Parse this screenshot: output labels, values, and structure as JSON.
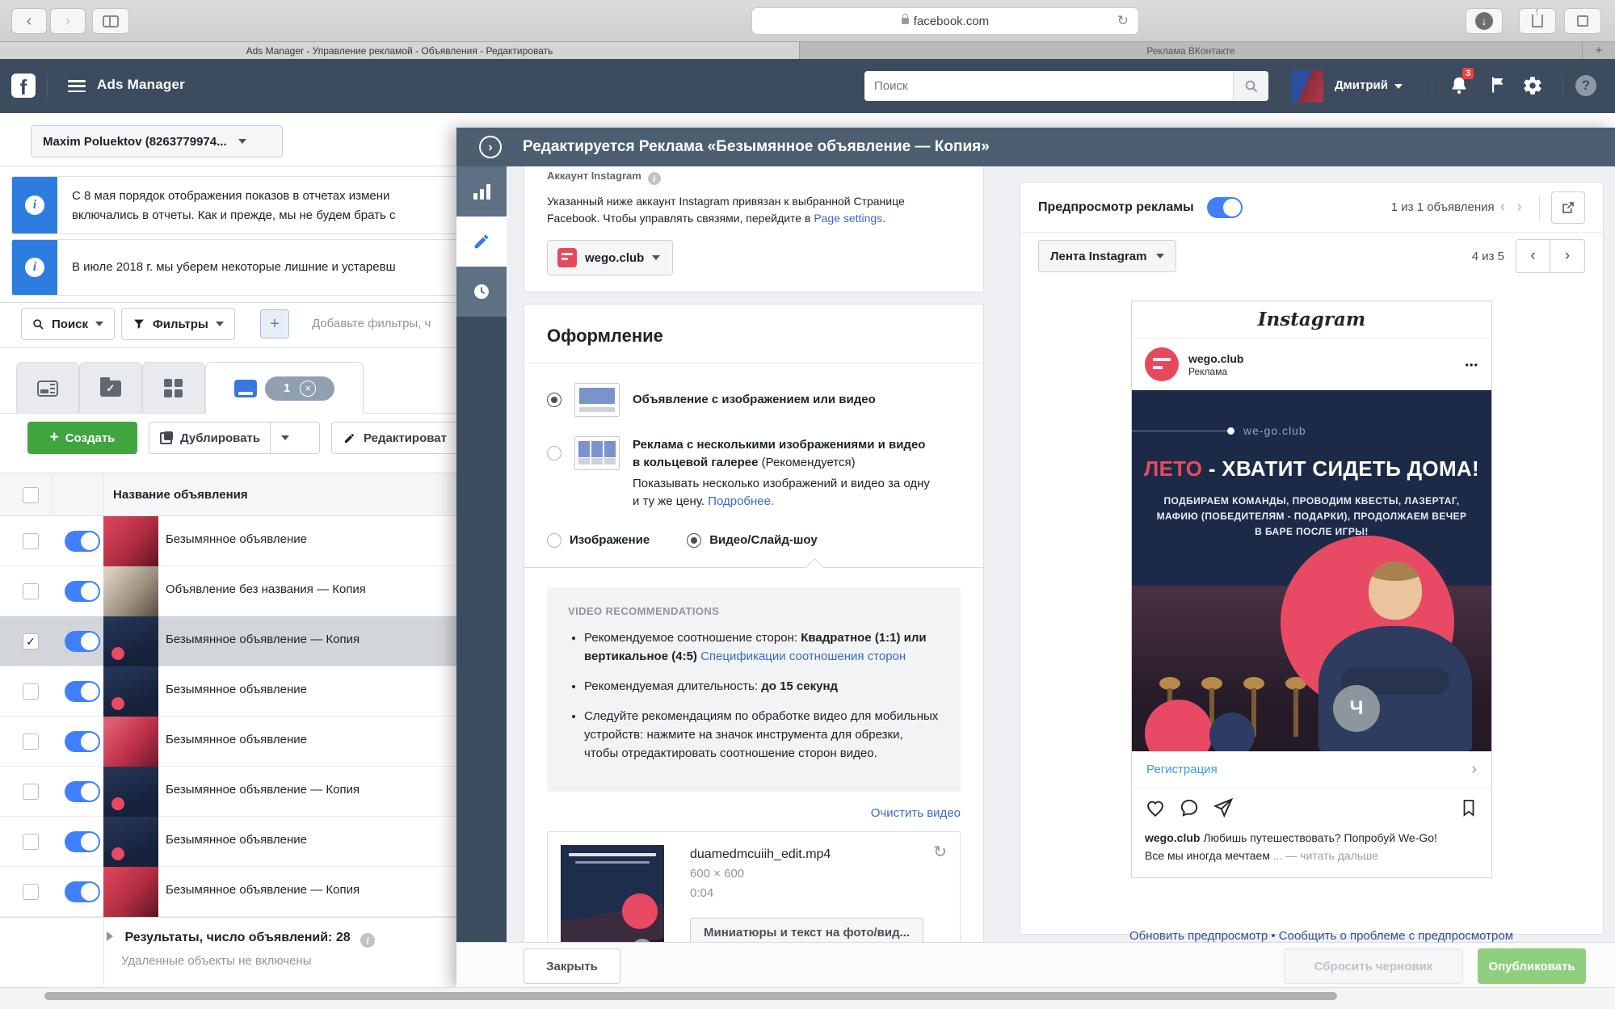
{
  "browser": {
    "url": "facebook.com",
    "tabs": [
      {
        "title": "Ads Manager - Управление рекламой - Объявления - Редактировать"
      },
      {
        "title": "Реклама ВКонтакте"
      }
    ],
    "new_tab_label": "+"
  },
  "icons": {
    "back": "‹",
    "forward": "›",
    "reload": "↻",
    "download_arrow": "↓",
    "plus": "+",
    "check": "✓",
    "dots": "•••",
    "chevron_right": "›",
    "chevron_left": "‹",
    "question": "?",
    "info": "i",
    "close": "×",
    "refresh": "↻"
  },
  "header": {
    "app_title": "Ads Manager",
    "search_placeholder": "Поиск",
    "user_name": "Дмитрий",
    "notification_count": "3"
  },
  "left_panel": {
    "account_selector": "Maxim Poluektov (8263779974...",
    "banners": [
      {
        "line1": "С 8 мая порядок отображения показов в отчетах измени",
        "line2": "включались в отчеты. Как и прежде, мы не будем брать с"
      },
      {
        "line1": "В июле 2018 г. мы уберем некоторые лишние и устаревш",
        "line2": ""
      }
    ],
    "search_button": "Поиск",
    "filters_button": "Фильтры",
    "filters_placeholder": "Добавьте фильтры, ч",
    "active_tab_badge": "1",
    "toolbar": {
      "create": "Создать",
      "duplicate": "Дублировать",
      "edit": "Редактироват"
    },
    "table": {
      "name_header": "Название объявления",
      "rows": [
        {
          "name": "Безымянное объявление",
          "checked": false
        },
        {
          "name": "Объявление без названия — Копия",
          "checked": false
        },
        {
          "name": "Безымянное объявление — Копия",
          "checked": true
        },
        {
          "name": "Безымянное объявление",
          "checked": false
        },
        {
          "name": "Безымянное объявление",
          "checked": false
        },
        {
          "name": "Безымянное объявление — Копия",
          "checked": false
        },
        {
          "name": "Безымянное объявление",
          "checked": false
        },
        {
          "name": "Безымянное объявление — Копия",
          "checked": false
        }
      ],
      "results": "Результаты, число объявлений: 28",
      "results_note": "Удаленные объекты не включены"
    }
  },
  "editor": {
    "title": "Редактируется Реклама «Безымянное объявление — Копия»",
    "instagram": {
      "heading": "Аккаунт Instagram",
      "body": "Указанный ниже аккаунт Instagram привязан к выбранной Странице Facebook. Чтобы управлять связями, перейдите в ",
      "link": "Page settings",
      "period": ".",
      "account": "wego.club"
    },
    "format": {
      "heading": "Оформление",
      "single_label": "Объявление с изображением или видео",
      "carousel_bold": "Реклама с несколькими изображениями и видео в кольцевой галерее",
      "carousel_tag": " (Рекомендуется)",
      "carousel_desc": "Показывать несколько изображений и видео за одну и ту же цену. ",
      "carousel_link": "Подробнее.",
      "image_label": "Изображение",
      "video_label": "Видео/Слайд-шоу"
    },
    "video_recs": {
      "heading": "VIDEO RECOMMENDATIONS",
      "b1_pre": "Рекомендуемое соотношение сторон: ",
      "b1_bold": "Квадратное (1:1) или вертикальное (4:5) ",
      "b1_link": "Спецификации соотношения сторон",
      "b2_pre": "Рекомендуемая длительность: ",
      "b2_bold": "до 15 секунд",
      "b3": "Следуйте рекомендациям по обработке видео для мобильных устройств: нажмите на значок инструмента для обрезки, чтобы отредактировать соотношение сторон видео."
    },
    "clear_video": "Очистить видео",
    "video": {
      "filename": "duamedmcuiih_edit.mp4",
      "dimensions": "600 × 600",
      "duration": "0:04",
      "thumbs_button": "Миниатюры и текст на фото/вид..."
    },
    "close_button": "Закрыть"
  },
  "preview": {
    "title": "Предпросмотр рекламы",
    "ads_counter": "1 из 1 объявления",
    "placement": "Лента Instagram",
    "placement_counter": "4 из 5",
    "ig": {
      "wordmark": "Instagram",
      "account": "wego.club",
      "sponsored": "Реклама",
      "ad_brand": "we-go.club",
      "headline_accent": "ЛЕТО",
      "headline_rest": " - ХВАТИТ СИДЕТЬ ДОМА!",
      "subtitle": "ПОДБИРАЕМ КОМАНДЫ, ПРОВОДИМ КВЕСТЫ, ЛАЗЕРТАГ, МАФИЮ (ПОБЕДИТЕЛЯМ - ПОДАРКИ), ПРОДОЛЖАЕМ ВЕЧЕР В БАРЕ ПОСЛЕ ИГРЫ!",
      "watermark": "Ч",
      "cta": "Регистрация",
      "caption_account": "wego.club",
      "caption_text": " Любишь путешествовать? Попробуй We-Go!",
      "caption_line2": "Все мы иногда мечтаем ",
      "caption_more": "... — читать дальше"
    },
    "refresh_link": "Обновить предпросмотр",
    "separator": "•",
    "report_link": "Сообщить о проблеме с предпросмотром",
    "reset_button": "Сбросить черновик",
    "publish_button": "Опубликовать"
  },
  "colors": {
    "fb_header": "#3c4b5d",
    "accent_blue": "#3578e5",
    "toggle_blue": "#4080ff",
    "link_blue": "#3b6bbf",
    "create_green": "#3fa53f",
    "publish_green": "#8fce7f",
    "badge_red": "#fa3e3e",
    "ad_navy": "#1c2a47",
    "ad_pink": "#e84a63",
    "ig_cta_blue": "#3897f0"
  }
}
